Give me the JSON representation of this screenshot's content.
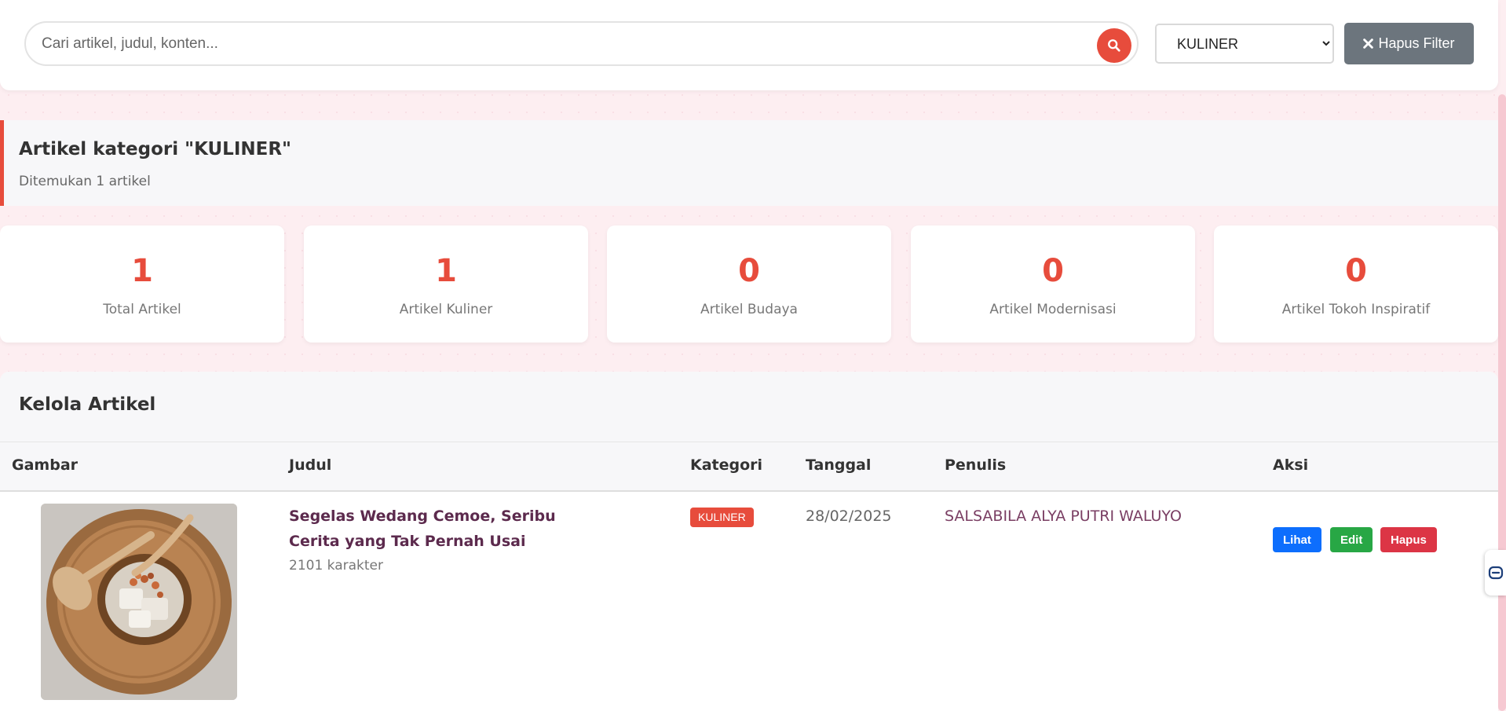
{
  "search": {
    "placeholder": "Cari artikel, judul, konten...",
    "value": "",
    "button_icon": "search-icon"
  },
  "filter": {
    "selected": "KULINER",
    "clear_label": "Hapus Filter",
    "clear_icon": "close-icon"
  },
  "result": {
    "title": "Artikel kategori \"KULINER\"",
    "subtitle": "Ditemukan 1 artikel"
  },
  "stats": [
    {
      "value": "1",
      "label": "Total Artikel"
    },
    {
      "value": "1",
      "label": "Artikel Kuliner"
    },
    {
      "value": "0",
      "label": "Artikel Budaya"
    },
    {
      "value": "0",
      "label": "Artikel Modernisasi"
    },
    {
      "value": "0",
      "label": "Artikel Tokoh Inspiratif"
    }
  ],
  "table": {
    "title": "Kelola Artikel",
    "headers": [
      "Gambar",
      "Judul",
      "Kategori",
      "Tanggal",
      "Penulis",
      "Aksi"
    ],
    "rows": [
      {
        "image_icon": "food-photo",
        "title": "Segelas Wedang Cemoe, Seribu Cerita yang Tak Pernah Usai",
        "chars": "2101 karakter",
        "category": "KULINER",
        "date": "28/02/2025",
        "author": "SALSABILA ALYA PUTRI WALUYO",
        "actions": {
          "view": "Lihat",
          "edit": "Edit",
          "delete": "Hapus"
        }
      }
    ]
  },
  "colors": {
    "accent": "#e74c3c",
    "background": "#fdeef1",
    "view": "#0d6efd",
    "edit": "#28a745",
    "delete": "#dc3545",
    "secondary": "#6c757d"
  }
}
